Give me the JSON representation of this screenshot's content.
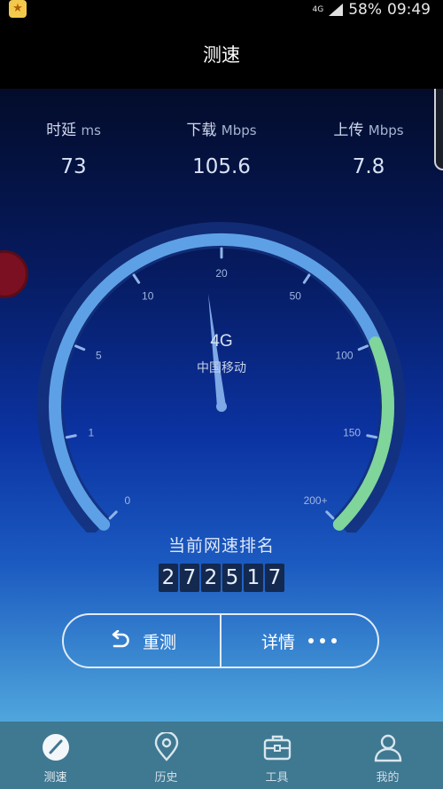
{
  "status_bar": {
    "net_type": "4G",
    "battery": "58%",
    "time": "09:49",
    "app_icon": "app-notification-icon"
  },
  "title_bar": {
    "title": "测速"
  },
  "stats": [
    {
      "label": "时延",
      "unit": "ms",
      "value": "73"
    },
    {
      "label": "下载",
      "unit": "Mbps",
      "value": "105.6"
    },
    {
      "label": "上传",
      "unit": "Mbps",
      "value": "7.8"
    }
  ],
  "gauge": {
    "network": "4G",
    "carrier": "中国移动",
    "scale_labels": [
      "0",
      "1",
      "5",
      "10",
      "20",
      "50",
      "100",
      "150",
      "200+"
    ],
    "needle_value_index": 3.8,
    "progress_end_label": "100",
    "colors": {
      "track": "#5ea0e6",
      "progress": "#7fd59a",
      "ring": "#14307a"
    }
  },
  "rank": {
    "title": "当前网速排名",
    "digits": [
      "2",
      "7",
      "2",
      "5",
      "1",
      "7"
    ]
  },
  "actions": {
    "retest_label": "重测",
    "details_label": "详情",
    "retest_icon": "undo-icon",
    "more_icon": "more-dots-icon"
  },
  "nav": [
    {
      "label": "测速",
      "icon": "speedometer-icon",
      "active": true
    },
    {
      "label": "历史",
      "icon": "location-pin-icon",
      "active": false
    },
    {
      "label": "工具",
      "icon": "toolbox-icon",
      "active": false
    },
    {
      "label": "我的",
      "icon": "user-icon",
      "active": false
    }
  ]
}
